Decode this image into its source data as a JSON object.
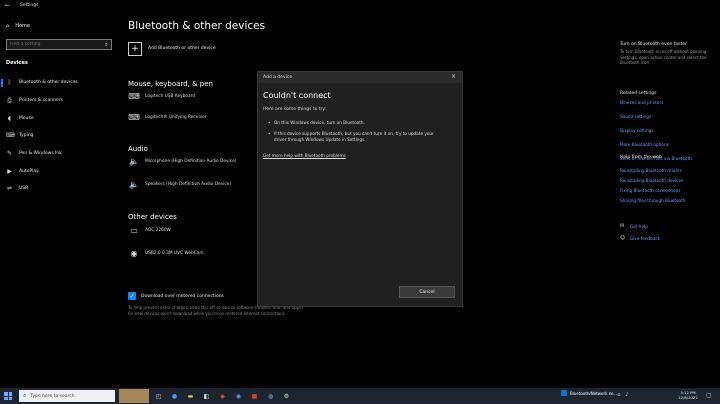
{
  "window": {
    "title": "Settings",
    "back_glyph": "←"
  },
  "sidebar": {
    "home_label": "Home",
    "search_placeholder": "Find a setting",
    "section_label": "Devices",
    "items": [
      {
        "label": "Bluetooth & other devices",
        "icon": "bluetooth-icon",
        "glyph": "ᛒ"
      },
      {
        "label": "Printers & scanners",
        "icon": "printer-icon",
        "glyph": "⎙"
      },
      {
        "label": "Mouse",
        "icon": "mouse-icon",
        "glyph": "◖"
      },
      {
        "label": "Typing",
        "icon": "keyboard-icon",
        "glyph": "⌨"
      },
      {
        "label": "Pen & Windows Ink",
        "icon": "pen-icon",
        "glyph": "✎"
      },
      {
        "label": "AutoPlay",
        "icon": "autoplay-icon",
        "glyph": "▶"
      },
      {
        "label": "USB",
        "icon": "usb-icon",
        "glyph": "⇌"
      }
    ]
  },
  "main": {
    "title": "Bluetooth & other devices",
    "add_label": "Add Bluetooth or other device",
    "groups": {
      "mouse": {
        "header": "Mouse, keyboard, & pen",
        "devices": [
          "Logitech USB Keyboard",
          "Logitech® Unifying Receiver"
        ]
      },
      "audio": {
        "header": "Audio",
        "devices": [
          "Microphone (High Definition Audio Device)",
          "Speakers (High Definition Audio Device)"
        ]
      },
      "other": {
        "header": "Other devices",
        "devices": [
          "AOC 2260W",
          "USB2.0 0.3M UVC WebCam"
        ]
      }
    },
    "metered_label": "Download over metered connections",
    "metered_note": "To help prevent extra charges, keep this off so device software (drivers, info, and apps) for new devices won't download while you're on metered Internet connections."
  },
  "dialog": {
    "title": "Add a device",
    "heading": "Couldn't connect",
    "intro": "Here are some things to try:",
    "tips": [
      "On this Windows device, turn on Bluetooth.",
      "If this device supports Bluetooth, but you can't turn it on, try to update your driver through Windows Update in Settings."
    ],
    "help_link": "Get more help with Bluetooth problems",
    "cancel_label": "Cancel"
  },
  "right_panel": {
    "turn_on_header": "Turn on Bluetooth even faster",
    "turn_on_text": "To turn Bluetooth on or off without opening Settings, open action center and select the Bluetooth icon.",
    "related_header": "Related settings",
    "related_links": [
      "Devices and printers",
      "Sound settings",
      "Display settings",
      "More Bluetooth options",
      "Send or receive files via Bluetooth"
    ],
    "help_header": "Help from the web",
    "help_links": [
      "Reinstalling Bluetooth drivers",
      "Reinstalling Bluetooth devices",
      "Fixing Bluetooth connections",
      "Sharing files through Bluetooth"
    ],
    "get_help": "Get help",
    "give_feedback": "Give feedback"
  },
  "taskbar": {
    "search_placeholder": "Type here to search",
    "notification": "Bluetooth/Network ce...",
    "time": "3:12 PM",
    "date": "12/8/2022"
  }
}
